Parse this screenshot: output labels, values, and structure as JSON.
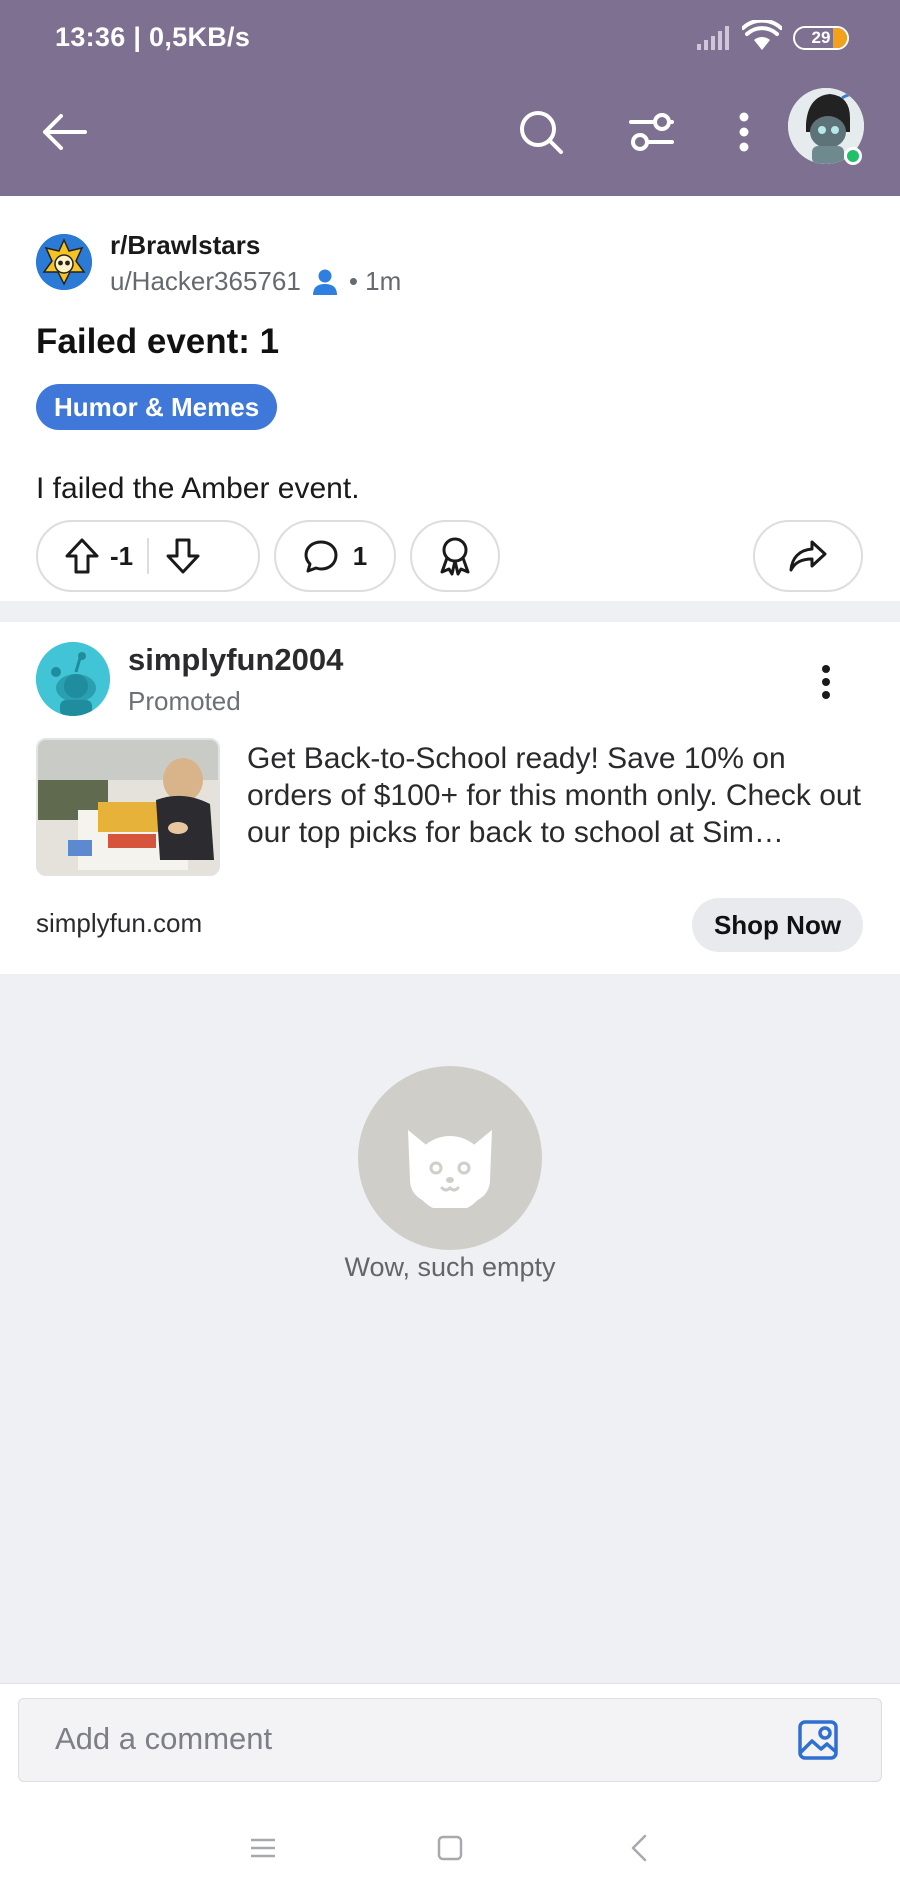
{
  "status_bar": {
    "time_speed": "13:36 | 0,5KB/s",
    "battery_level": "29"
  },
  "post": {
    "subreddit": "r/Brawlstars",
    "author": "u/Hacker365761",
    "age": "• 1m",
    "title": "Failed event: 1",
    "flair": "Humor & Memes",
    "body": "I failed the Amber event.",
    "score": "-1",
    "comment_count": "1"
  },
  "ad": {
    "advertiser": "simplyfun2004",
    "promoted_label": "Promoted",
    "text": "Get Back-to-School ready! Save 10% on orders of $100+ for this month only. Check out our top picks for back to school at Sim…",
    "domain": "simplyfun.com",
    "cta": "Shop Now"
  },
  "empty_state": {
    "message": "Wow, such empty"
  },
  "comment_input": {
    "placeholder": "Add a comment"
  },
  "colors": {
    "header": "#7e7090",
    "flair": "#3f78d9",
    "online": "#20c06a",
    "battery": "#f3a11d"
  }
}
